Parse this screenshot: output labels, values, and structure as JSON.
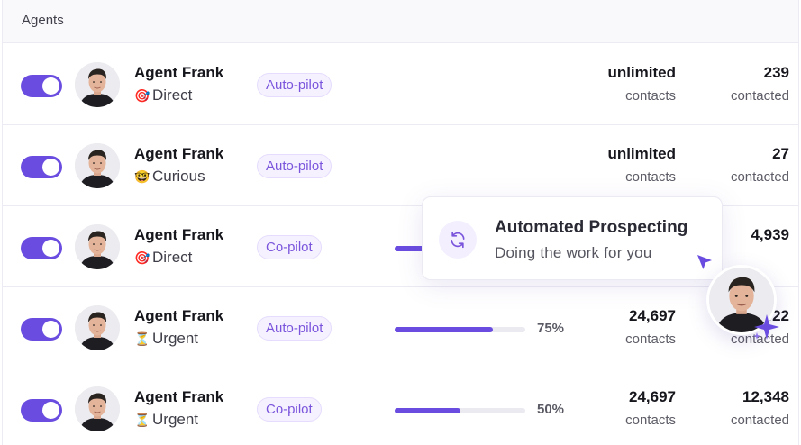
{
  "header": {
    "title": "Agents"
  },
  "rows": [
    {
      "name": "Agent Frank",
      "mood_icon": "target-icon",
      "mood_glyph": "🎯",
      "mood": "Direct",
      "mode": "Auto-pilot",
      "progress_percent": null,
      "progress_label": "",
      "contacts_value": "unlimited",
      "contacts_label": "contacts",
      "contacted_value": "239",
      "contacted_label": "contacted"
    },
    {
      "name": "Agent Frank",
      "mood_icon": "nerd-face-icon",
      "mood_glyph": "🤓",
      "mood": "Curious",
      "mode": "Auto-pilot",
      "progress_percent": null,
      "progress_label": "",
      "contacts_value": "unlimited",
      "contacts_label": "contacts",
      "contacted_value": "27",
      "contacted_label": "contacted"
    },
    {
      "name": "Agent Frank",
      "mood_icon": "target-icon",
      "mood_glyph": "🎯",
      "mood": "Direct",
      "mode": "Co-pilot",
      "progress_percent": null,
      "progress_label": "",
      "contacts_value": "",
      "contacts_label": "",
      "contacted_value": "4,939",
      "contacted_label": ""
    },
    {
      "name": "Agent Frank",
      "mood_icon": "hourglass-icon",
      "mood_glyph": "⏳",
      "mood": "Urgent",
      "mode": "Auto-pilot",
      "progress_percent": 75,
      "progress_label": "75%",
      "contacts_value": "24,697",
      "contacts_label": "contacts",
      "contacted_value": "…22",
      "contacted_label": "contacted"
    },
    {
      "name": "Agent Frank",
      "mood_icon": "hourglass-icon",
      "mood_glyph": "⏳",
      "mood": "Urgent",
      "mode": "Co-pilot",
      "progress_percent": 50,
      "progress_label": "50%",
      "contacts_value": "24,697",
      "contacts_label": "contacts",
      "contacted_value": "12,348",
      "contacted_label": "contacted"
    }
  ],
  "popup": {
    "title": "Automated Prospecting",
    "subtitle": "Doing the work for you",
    "icon": "refresh-icon"
  },
  "colors": {
    "accent": "#6a4de0",
    "badge_bg": "#f5f1ff",
    "badge_text": "#7a55dc"
  }
}
